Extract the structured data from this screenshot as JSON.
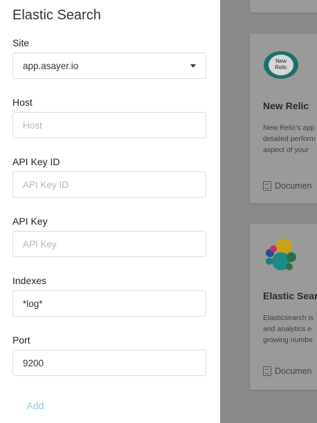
{
  "panel": {
    "title": "Elastic Search",
    "fields": {
      "site": {
        "label": "Site",
        "value": "app.asayer.io"
      },
      "host": {
        "label": "Host",
        "value": "",
        "placeholder": "Host"
      },
      "api_key_id": {
        "label": "API Key ID",
        "value": "",
        "placeholder": "API Key ID"
      },
      "api_key": {
        "label": "API Key",
        "value": "",
        "placeholder": "API Key"
      },
      "indexes": {
        "label": "Indexes",
        "value": "*log*"
      },
      "port": {
        "label": "Port",
        "value": "9200"
      }
    },
    "add_label": "Add"
  },
  "background": {
    "cards": [
      {
        "title": "New Relic",
        "logo_text": "New\nRelic",
        "desc": [
          "New Relic's app",
          "detailed perform",
          "aspect of your"
        ],
        "doc_label": "Documen"
      },
      {
        "title": "Elastic Sear",
        "desc": [
          "Elasticsearch is",
          "and analytics e",
          "growing numbe"
        ],
        "doc_label": "Documen"
      }
    ]
  },
  "colors": {
    "accent": "#8fcde0",
    "overlay": "#7a7a7a",
    "panel_bg": "#ffffff"
  }
}
